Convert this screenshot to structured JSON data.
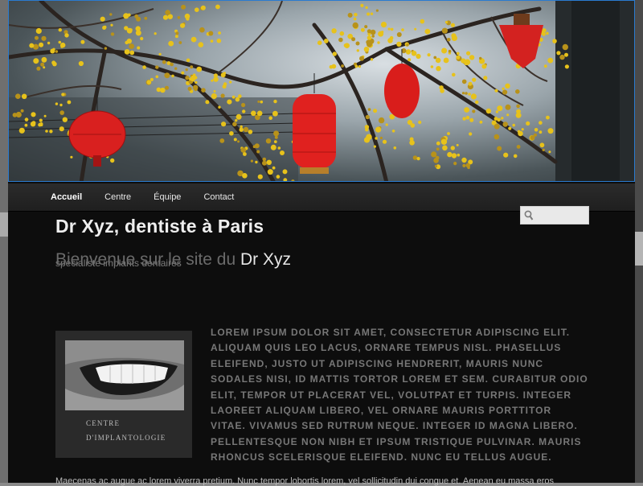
{
  "nav": {
    "items": [
      "Accueil",
      "Centre",
      "Équipe",
      "Contact"
    ],
    "current_index": 0
  },
  "site": {
    "title": "Dr Xyz, dentiste à Paris",
    "description": "spécialiste implants dentaires"
  },
  "search": {
    "placeholder": ""
  },
  "entry": {
    "title_prefix": "Bienvenue sur le site du ",
    "title_highlight": "Dr Xyz"
  },
  "caption": {
    "line1": "Centre",
    "line2": "d'implantologie"
  },
  "content": {
    "lorem": "Lorem ipsum dolor sit amet, consectetur adipiscing elit. Aliquam quis leo lacus, ornare tempus nisl. Phasellus eleifend, justo ut adipiscing hendrerit, mauris nunc sodales nisi, id mattis tortor lorem et sem. Curabitur odio elit, tempor ut placerat vel, volutpat et turpis. Integer laoreet aliquam libero, vel ornare mauris porttitor vitae. Vivamus sed rutrum neque. Integer id magna libero. Pellentesque non nibh et ipsum tristique pulvinar. Mauris rhoncus scelerisque eleifend. Nunc eu tellus augue.",
    "para2": "Maecenas ac augue ac lorem viverra pretium. Nunc tempor lobortis lorem, vel sollicitudin dui congue et. Aenean eu massa eros"
  },
  "colors": {
    "page_bg": "#0d0d0d",
    "banner_border": "#2a7bd0",
    "lantern_red": "#d9201f",
    "blossom_yellow": "#e7c21b"
  },
  "icons": {
    "search": "magnifier-icon"
  }
}
